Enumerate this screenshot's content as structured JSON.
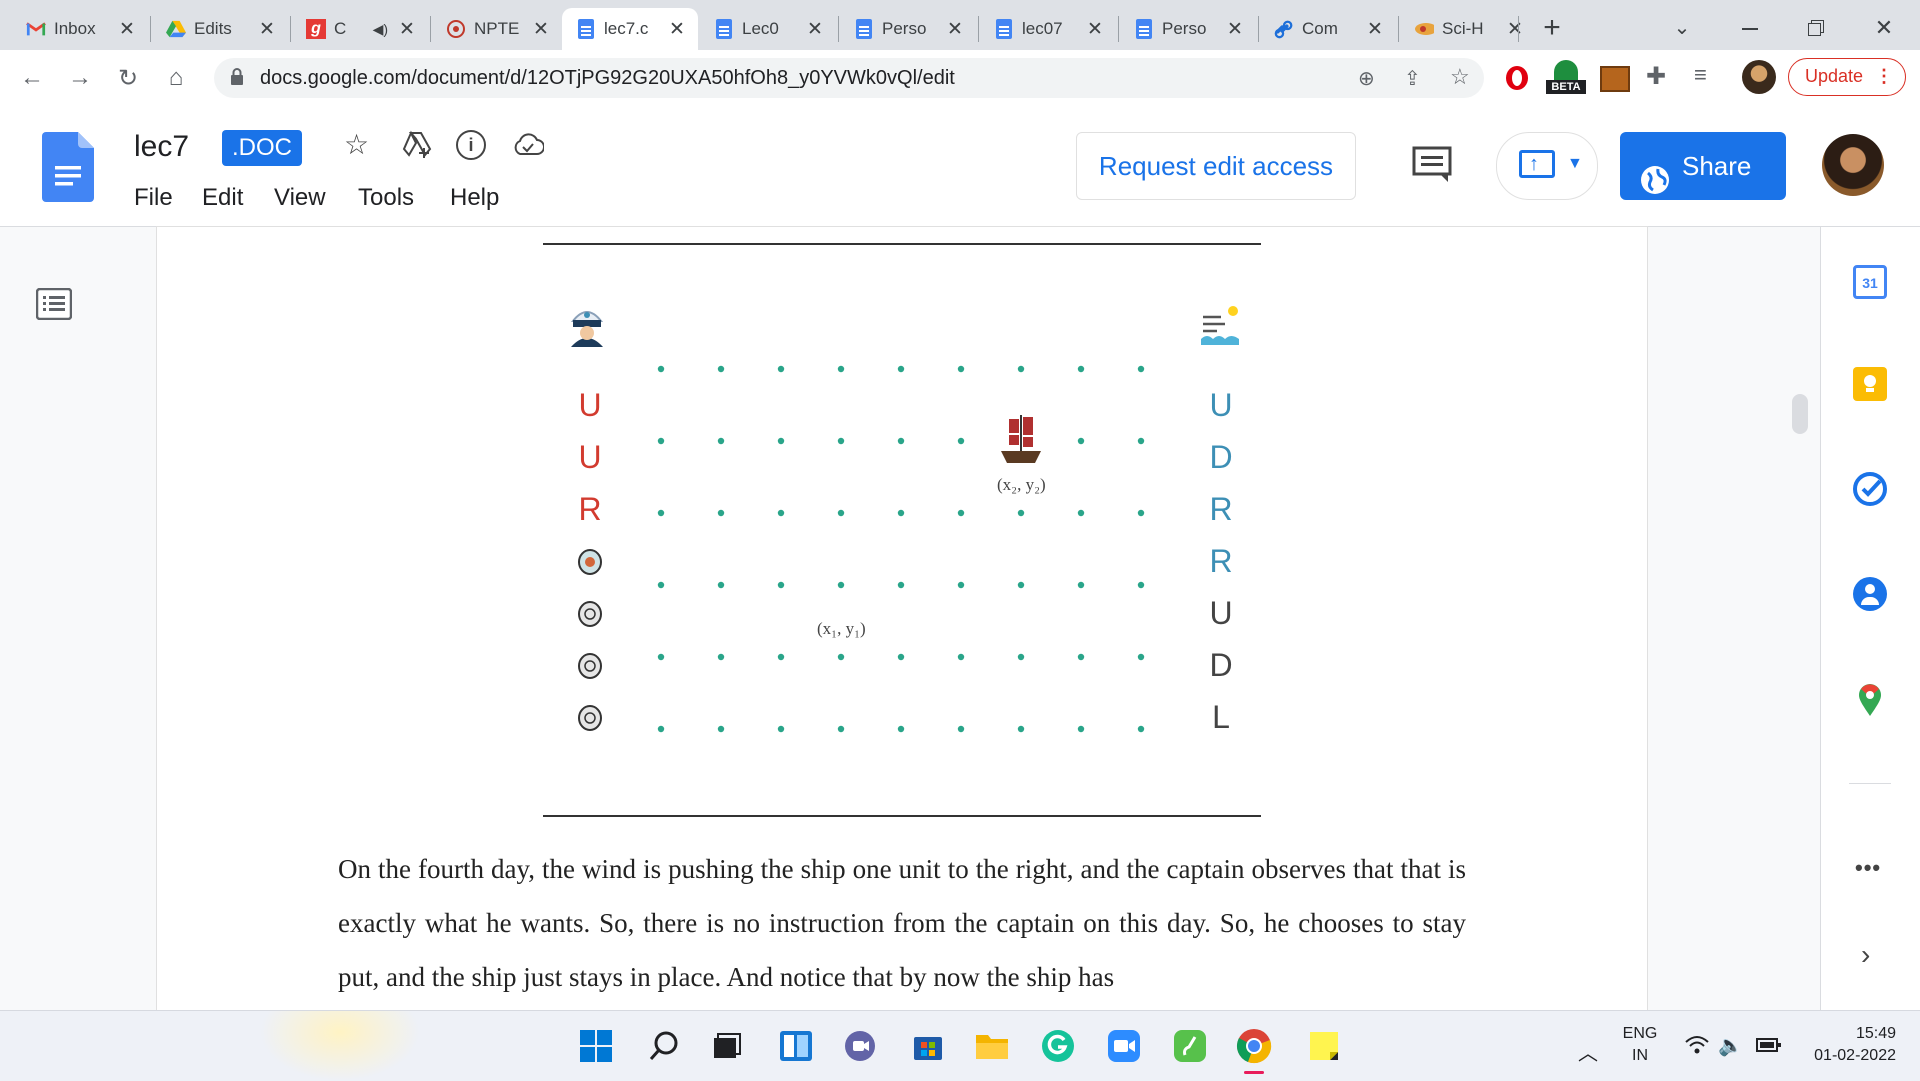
{
  "tabs": [
    {
      "title": "Inbox",
      "icon": "gmail-icon"
    },
    {
      "title": "Edits",
      "icon": "drive-icon"
    },
    {
      "title": "C",
      "icon": "g-red-icon"
    },
    {
      "title": "NPTE",
      "icon": "nptel-icon"
    },
    {
      "title": "lec7.c",
      "icon": "docs-icon",
      "active": true
    },
    {
      "title": "Lec0",
      "icon": "docs-icon"
    },
    {
      "title": "Perso",
      "icon": "docs-icon"
    },
    {
      "title": "lec07",
      "icon": "docs-icon"
    },
    {
      "title": "Perso",
      "icon": "docs-icon"
    },
    {
      "title": "Com",
      "icon": "link-icon"
    },
    {
      "title": "Sci-H",
      "icon": "scihub-icon"
    }
  ],
  "browser": {
    "url": "docs.google.com/document/d/12OTjPG92G20UXA50hfOh8_y0YVWk0vQl/edit",
    "beta_label": "BETA",
    "update_label": "Update"
  },
  "doc": {
    "title": "lec7",
    "badge": ".DOC",
    "menu": [
      "File",
      "Edit",
      "View",
      "Tools",
      "Help"
    ],
    "request_edit": "Request edit access",
    "share": "Share"
  },
  "figure": {
    "left_moves": [
      "U",
      "U",
      "R"
    ],
    "right_moves": [
      "U",
      "D",
      "R",
      "R",
      "U",
      "D",
      "L"
    ],
    "label_start": "(x₁, y₁)",
    "label_end": "(x₂, y₂)",
    "grid_cols": 9,
    "grid_rows": 6,
    "dot_color": "#2aa58a",
    "left_color": "#d23b2f",
    "right_color": "#3d8fb5"
  },
  "body_text": "On the fourth day, the wind is pushing the ship one unit to the right, and the captain observes that that is exactly what he wants. So, there is no instruction from the captain on this day. So, he chooses to stay put, and the ship just stays in place. And notice that by now the ship has",
  "sidepanel": {
    "calendar_day": "31"
  },
  "taskbar": {
    "lang1": "ENG",
    "lang2": "IN",
    "time": "15:49",
    "date": "01-02-2022"
  },
  "colors": {
    "accent": "#1a73e8",
    "docs_blue": "#4285f4"
  }
}
